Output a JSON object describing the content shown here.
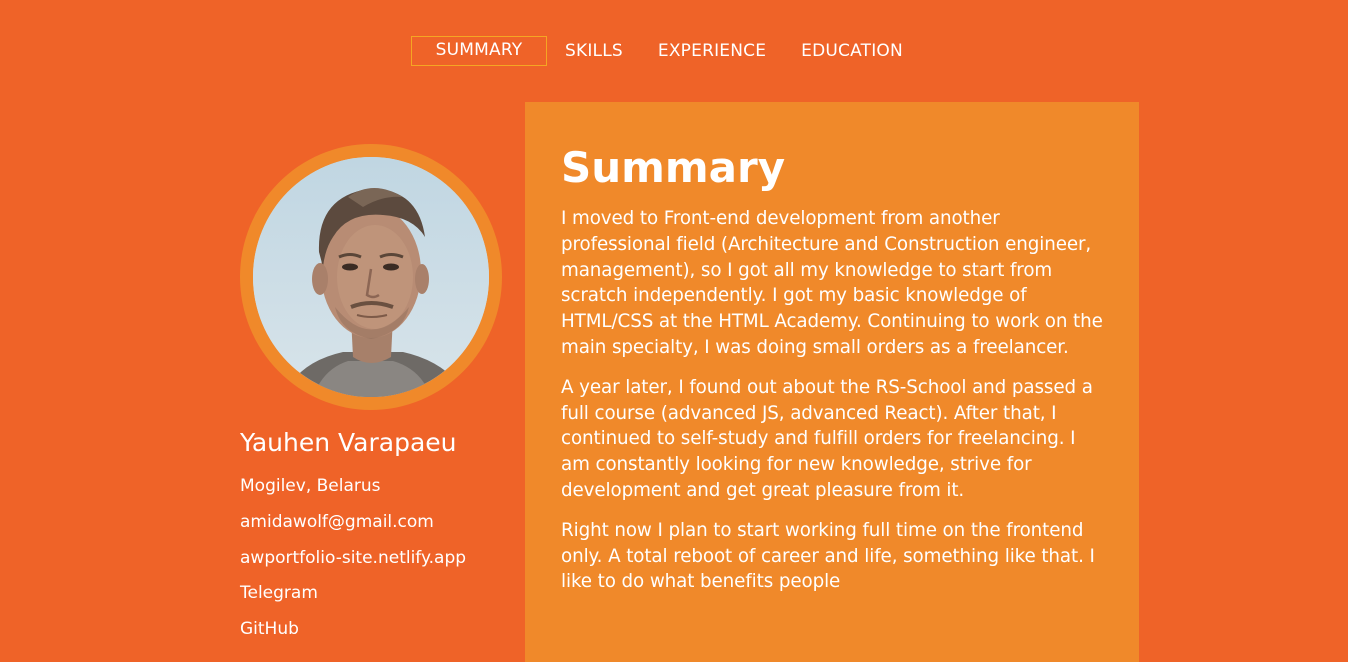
{
  "nav": {
    "items": [
      {
        "label": "SUMMARY",
        "active": true
      },
      {
        "label": "SKILLS",
        "active": false
      },
      {
        "label": "EXPERIENCE",
        "active": false
      },
      {
        "label": "EDUCATION",
        "active": false
      }
    ]
  },
  "profile": {
    "name": "Yauhen Varapaeu",
    "contacts": [
      "Mogilev, Belarus",
      "amidawolf@gmail.com",
      "awportfolio-site.netlify.app",
      "Telegram",
      "GitHub"
    ]
  },
  "summary": {
    "title": "Summary",
    "paragraphs": [
      "I moved to Front-end development from another professional field (Architecture and Construction engineer, management), so I got all my knowledge to start from scratch independently. I got my basic knowledge of HTML/CSS at the HTML Academy. Continuing to work on the main specialty, I was doing small orders as a freelancer.",
      "A year later, I found out about the RS-School and passed a full course (advanced JS, advanced React). After that, I continued to self-study and fulfill orders for freelancing. I am constantly looking for new knowledge, strive for development and get great pleasure from it.",
      "Right now I plan to start working full time on the frontend only. A total reboot of career and life, something like that. I like to do what benefits people"
    ]
  },
  "colors": {
    "background": "#ef6328",
    "panel": "#f0892a",
    "active_border": "#f5a623",
    "text": "#ffffff"
  }
}
